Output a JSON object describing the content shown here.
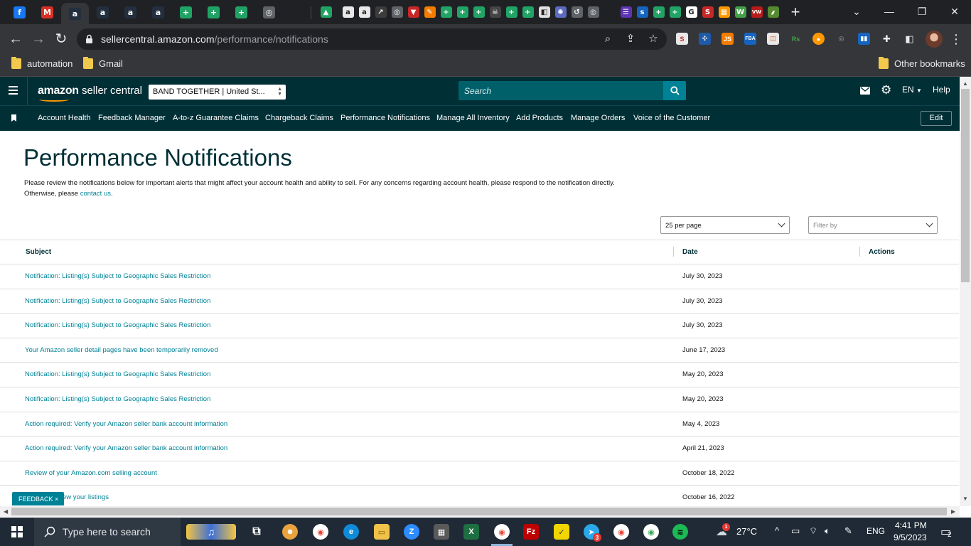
{
  "browser": {
    "url_host": "sellercentral.amazon.com",
    "url_path": "/performance/notifications",
    "bookmarks": [
      "automation",
      "Gmail"
    ],
    "other_bookmarks": "Other bookmarks",
    "new_tab": "+",
    "tabs": [
      {
        "icon": "facebook-icon",
        "glyph": "f",
        "color": "#1877f2"
      },
      {
        "icon": "gmail-icon",
        "glyph": "M",
        "color": "#d93025"
      },
      {
        "icon": "amazon-icon",
        "glyph": "a",
        "color": "#232f3e"
      },
      {
        "icon": "amazon-icon",
        "glyph": "a",
        "color": "#232f3e"
      },
      {
        "icon": "amazon-icon",
        "glyph": "a",
        "color": "#232f3e"
      },
      {
        "icon": "amazon-icon",
        "glyph": "a",
        "color": "#232f3e"
      },
      {
        "icon": "sheets-plus-icon",
        "glyph": "+",
        "color": "#21a366"
      },
      {
        "icon": "sheets-plus-icon",
        "glyph": "+",
        "color": "#21a366"
      },
      {
        "icon": "sheets-plus-icon",
        "glyph": "+",
        "color": "#21a366"
      },
      {
        "icon": "globe-icon",
        "glyph": "◎",
        "color": "#5f6368"
      }
    ],
    "small_tabs": [
      {
        "icon": "drive-icon",
        "glyph": "▲",
        "color": "#1fa463"
      },
      {
        "icon": "amazon-icon",
        "glyph": "a",
        "color": "#e8e8e8"
      },
      {
        "icon": "amazon-icon",
        "glyph": "a",
        "color": "#e8e8e8"
      },
      {
        "icon": "chart-icon",
        "glyph": "↗",
        "color": "#3c3c3c"
      },
      {
        "icon": "globe-icon",
        "glyph": "◎",
        "color": "#5f6368"
      },
      {
        "icon": "dropdown-icon",
        "glyph": "▼",
        "color": "#c62828"
      },
      {
        "icon": "tool-icon",
        "glyph": "✎",
        "color": "#f57c00"
      },
      {
        "icon": "sheets-plus-icon",
        "glyph": "+",
        "color": "#21a366"
      },
      {
        "icon": "sheets-plus-icon",
        "glyph": "+",
        "color": "#21a366"
      },
      {
        "icon": "sheets-plus-icon",
        "glyph": "+",
        "color": "#21a366"
      },
      {
        "icon": "skull-icon",
        "glyph": "☠",
        "color": "#444444"
      },
      {
        "icon": "sheets-plus-icon",
        "glyph": "+",
        "color": "#21a366"
      },
      {
        "icon": "sheets-plus-icon",
        "glyph": "+",
        "color": "#21a366"
      },
      {
        "icon": "image-icon",
        "glyph": "◧",
        "color": "#e0e0e0"
      },
      {
        "icon": "gear-flower-icon",
        "glyph": "✺",
        "color": "#5c6bc0"
      },
      {
        "icon": "history-icon",
        "glyph": "↺",
        "color": "#5f6368"
      },
      {
        "icon": "globe-icon",
        "glyph": "◎",
        "color": "#5f6368"
      },
      {
        "icon": "list-icon",
        "glyph": "☰",
        "color": "#5e35b1"
      },
      {
        "icon": "sysco-icon",
        "glyph": "s",
        "color": "#1565c0"
      },
      {
        "icon": "sheets-plus-icon",
        "glyph": "+",
        "color": "#21a366"
      },
      {
        "icon": "sheets-plus-icon",
        "glyph": "+",
        "color": "#21a366"
      },
      {
        "icon": "google-icon",
        "glyph": "G",
        "color": "#ffffff"
      },
      {
        "icon": "sale-icon",
        "glyph": "S",
        "color": "#c62828"
      },
      {
        "icon": "tiles-icon",
        "glyph": "▦",
        "color": "#ff9800"
      },
      {
        "icon": "w-icon",
        "glyph": "W",
        "color": "#43a047"
      },
      {
        "icon": "vw-icon",
        "glyph": "VW",
        "color": "#b71c1c"
      },
      {
        "icon": "leaf-icon",
        "glyph": "⸙",
        "color": "#558b2f"
      }
    ]
  },
  "seller_central": {
    "logo_bold": "amazon",
    "logo_rest": " seller central",
    "account": "BAND TOGETHER | United St...",
    "search_placeholder": "Search",
    "language": "EN",
    "help": "Help",
    "nav": [
      "Account Health",
      "Feedback Manager",
      "A-to-z Guarantee Claims",
      "Chargeback Claims",
      "Performance Notifications",
      "Manage All Inventory",
      "Add Products",
      "Manage Orders",
      "Voice of the Customer"
    ],
    "edit": "Edit"
  },
  "page": {
    "title": "Performance Notifications",
    "intro": "Please review the notifications below for important alerts that might affect your account health and ability to sell. For any concerns regarding account health, please respond to the notification directly. Otherwise, please ",
    "contact_link": "contact us",
    "intro_end": ".",
    "per_page": "25 per page",
    "filter_placeholder": "Filter by",
    "columns": {
      "subject": "Subject",
      "date": "Date",
      "actions": "Actions"
    },
    "rows": [
      {
        "subject": "Notification: Listing(s) Subject to Geographic Sales Restriction",
        "date": "July 30, 2023"
      },
      {
        "subject": "Notification: Listing(s) Subject to Geographic Sales Restriction",
        "date": "July 30, 2023"
      },
      {
        "subject": "Notification: Listing(s) Subject to Geographic Sales Restriction",
        "date": "July 30, 2023"
      },
      {
        "subject": "Your Amazon seller detail pages have been temporarily removed",
        "date": "June 17, 2023"
      },
      {
        "subject": "Notification: Listing(s) Subject to Geographic Sales Restriction",
        "date": "May 20, 2023"
      },
      {
        "subject": "Notification: Listing(s) Subject to Geographic Sales Restriction",
        "date": "May 20, 2023"
      },
      {
        "subject": "Action required: Verify your Amazon seller bank account information",
        "date": "May 4, 2023"
      },
      {
        "subject": "Action required: Verify your Amazon seller bank account information",
        "date": "April 21, 2023"
      },
      {
        "subject": "Review of your Amazon.com selling account",
        "date": "October 18, 2022"
      },
      {
        "subject": "ew your listings",
        "date": "October 16, 2022"
      }
    ],
    "feedback": "FEEDBACK ×"
  },
  "taskbar": {
    "search_placeholder": "Type here to search",
    "weather": "27°C",
    "language": "ENG",
    "time": "4:41 PM",
    "date": "9/5/2023",
    "notification_count": "2",
    "telegram_badge": "3",
    "weather_badge": "1"
  }
}
